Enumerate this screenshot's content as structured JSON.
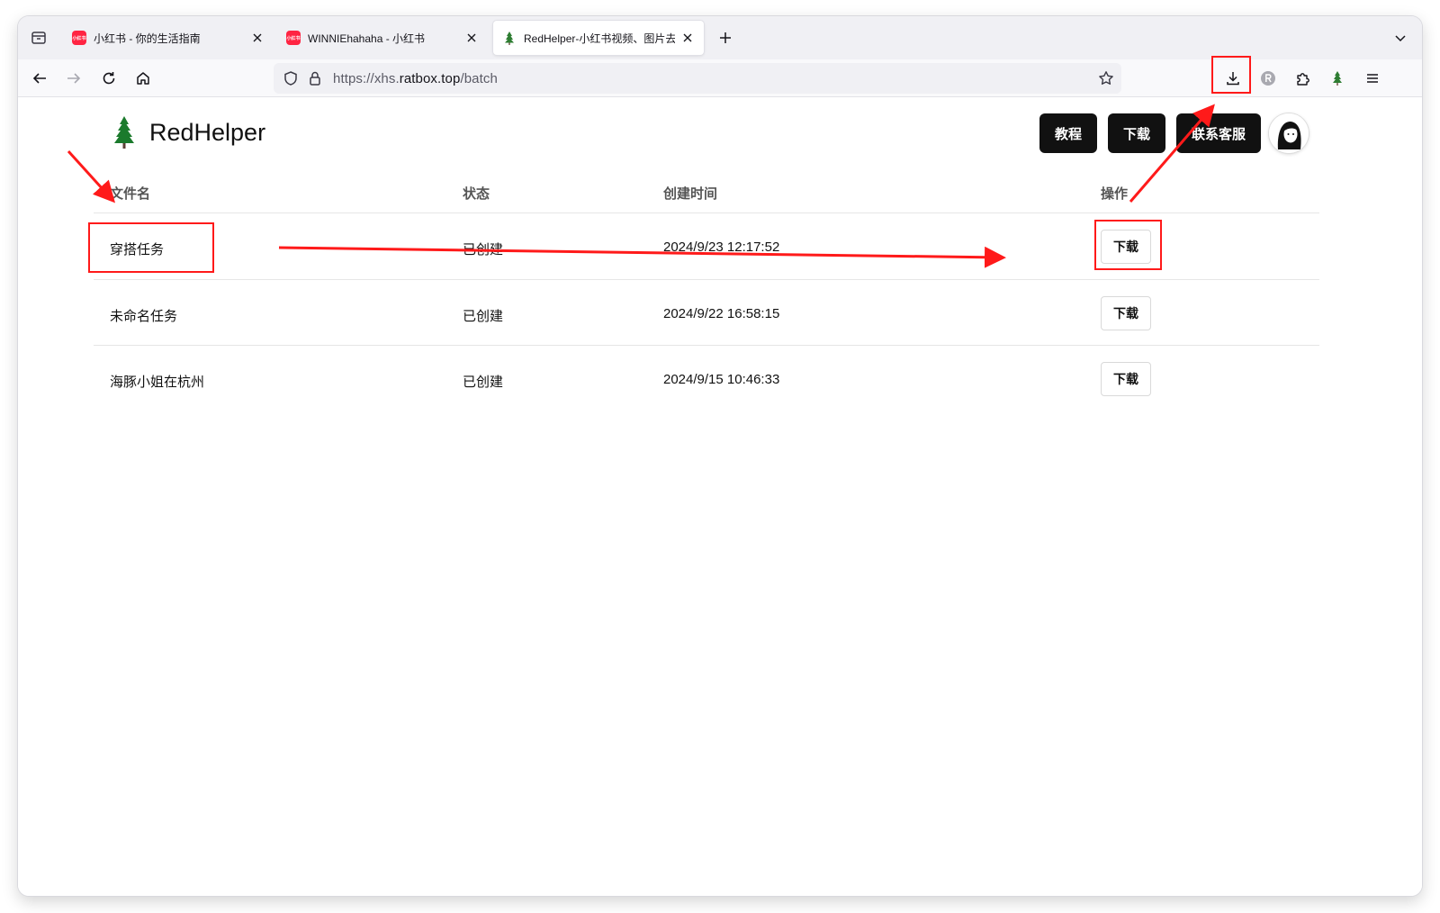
{
  "browser": {
    "tabs": [
      {
        "title": "小红书 - 你的生活指南",
        "favicon": "xiaohongshu-logo",
        "favicon_text": "小红书"
      },
      {
        "title": "WINNIEhahaha - 小红书",
        "favicon": "xiaohongshu-logo",
        "favicon_text": "小红书"
      },
      {
        "title": "RedHelper-小红书视频、图片去水",
        "favicon": "tree-icon",
        "active": true
      }
    ],
    "url": {
      "prefix": "https://xhs.",
      "host": "ratbox.top",
      "path": "/batch"
    }
  },
  "header": {
    "brand": "RedHelper",
    "buttons": {
      "tutorial": "教程",
      "download": "下载",
      "support": "联系客服"
    }
  },
  "table": {
    "columns": {
      "filename": "文件名",
      "status": "状态",
      "created": "创建时间",
      "actions": "操作"
    },
    "rows": [
      {
        "filename": "穿搭任务",
        "status": "已创建",
        "created": "2024/9/23 12:17:52",
        "action": "下载"
      },
      {
        "filename": "未命名任务",
        "status": "已创建",
        "created": "2024/9/22 16:58:15",
        "action": "下载"
      },
      {
        "filename": "海豚小姐在杭州",
        "status": "已创建",
        "created": "2024/9/15 10:46:33",
        "action": "下载"
      }
    ]
  },
  "colors": {
    "annotation": "#ff1a1a",
    "xhs_brand": "#ff2442",
    "tree": "#2e7d32"
  }
}
